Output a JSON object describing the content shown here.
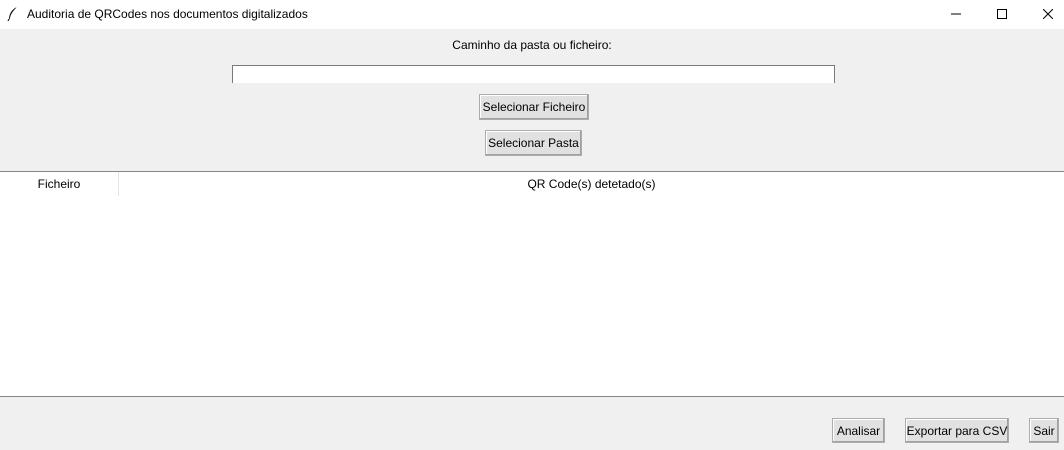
{
  "window": {
    "title": "Auditoria de QRCodes nos documentos digitalizados",
    "icon": "feather-icon",
    "controls": {
      "minimize_icon": "minimize-icon",
      "maximize_icon": "maximize-icon",
      "close_icon": "close-icon"
    }
  },
  "path": {
    "label": "Caminho da pasta ou ficheiro:",
    "value": "",
    "placeholder": ""
  },
  "buttons": {
    "select_file": "Selecionar Ficheiro",
    "select_folder": "Selecionar Pasta",
    "analyse": "Analisar",
    "export_csv": "Exportar para CSV",
    "exit": "Sair"
  },
  "results_table": {
    "columns": [
      "Ficheiro",
      "QR Code(s) detetado(s)"
    ],
    "rows": []
  }
}
